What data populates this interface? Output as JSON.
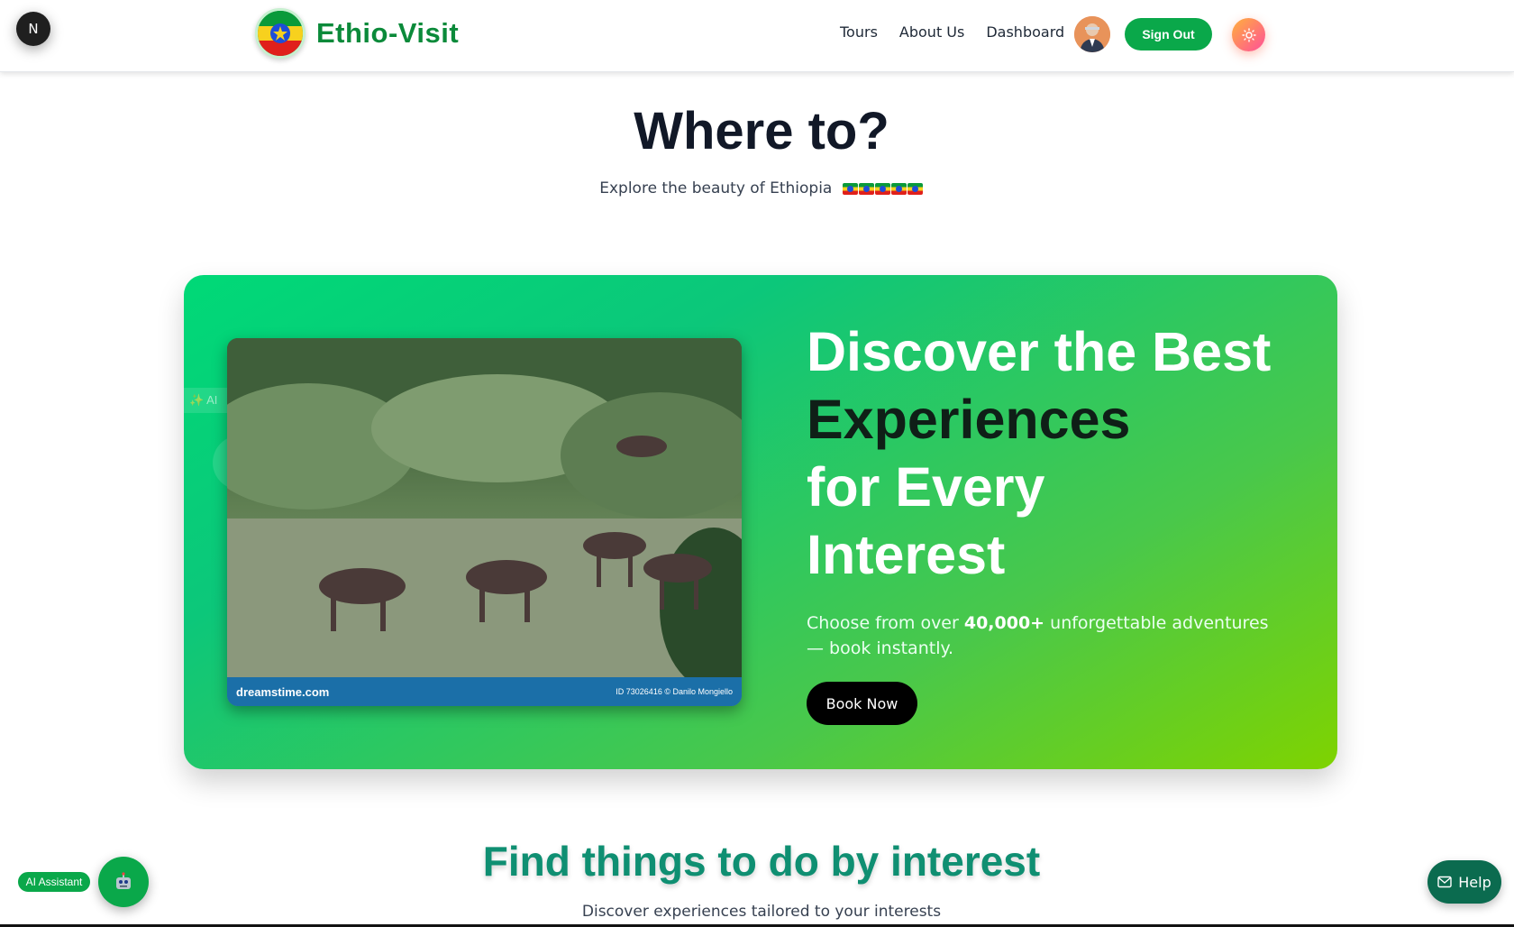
{
  "header": {
    "dev_badge": "N",
    "brand_name": "Ethio-Visit",
    "nav": [
      "Tours",
      "About Us",
      "Dashboard"
    ],
    "sign_out_label": "Sign Out",
    "theme_icon": "sun-icon"
  },
  "hero": {
    "title": "Where to?",
    "subtitle": "Explore the beauty of Ethiopia"
  },
  "card": {
    "headline_line1": "Discover the Best",
    "headline_line2": "Experiences",
    "headline_line3": "for Every",
    "headline_line4": "Interest",
    "desc_prefix": "Choose from over ",
    "desc_bold": "40,000+",
    "desc_suffix": " unforgettable adventures — book instantly.",
    "book_label": "Book Now",
    "photo_watermark_left": "dreamstime.com",
    "photo_watermark_right": "ID 73026416 © Danilo Mongiello",
    "ghost_label": "✨ AI"
  },
  "section": {
    "title": "Find things to do by interest",
    "subtitle": "Discover experiences tailored to your interests"
  },
  "widgets": {
    "ai_assistant_label": "AI Assistant",
    "ai_icon": "robot-icon",
    "help_label": "Help"
  },
  "colors": {
    "brand_green": "#0aa84a",
    "card_gradient_start": "#00d977",
    "card_gradient_end": "#7fd300",
    "section_title": "#0f8f72"
  }
}
